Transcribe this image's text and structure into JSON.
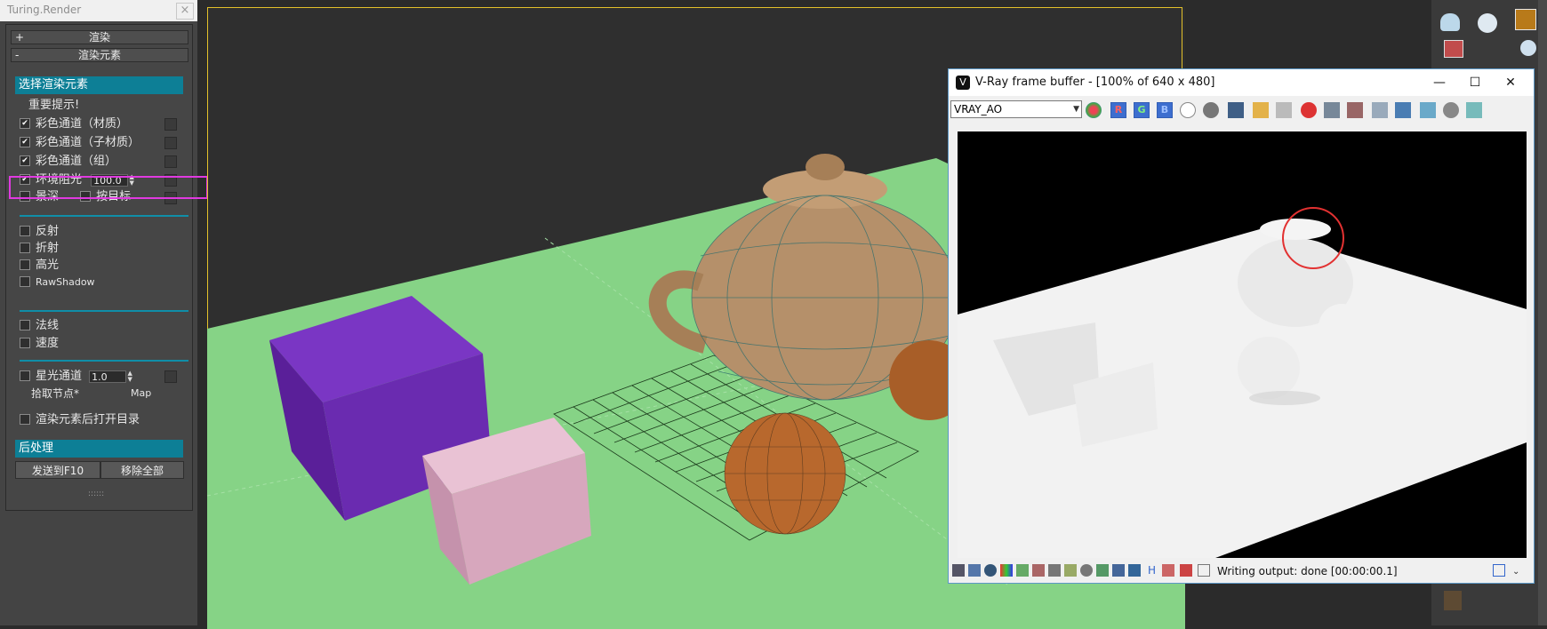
{
  "panel": {
    "title": "Turing.Render",
    "close_label": "×",
    "rollout_render": {
      "sign": "+",
      "label": "渲染"
    },
    "rollout_elements": {
      "sign": "-",
      "label": "渲染元素"
    },
    "select_header": "选择渲染元素",
    "important_note": "重要提示!",
    "channels": [
      {
        "label": "彩色通道（材质）",
        "checked": "✔"
      },
      {
        "label": "彩色通道（子材质）",
        "checked": "✔"
      },
      {
        "label": "彩色通道（组）",
        "checked": "✔"
      }
    ],
    "ao": {
      "label": "环境阻光",
      "checked": "✔",
      "value": "100.0"
    },
    "depth_label": "景深",
    "target_label": "按目标",
    "group2": [
      "反射",
      "折射",
      "高光",
      "RawShadow"
    ],
    "group3": [
      "法线",
      "速度"
    ],
    "glow": {
      "label": "星光通道",
      "value": "1.0"
    },
    "pick_node": "拾取节点*",
    "map": "Map",
    "open_dir": "渲染元素后打开目录",
    "post_header": "后处理",
    "send_btn": "发送到F10",
    "remove_btn": "移除全部",
    "grip": "::::::"
  },
  "vfb": {
    "title": "V-Ray frame buffer - [100% of 640 x 480]",
    "logo": "V",
    "minimize": "—",
    "maximize": "☐",
    "close": "✕",
    "channel": "VRAY_AO",
    "r": "R",
    "g": "G",
    "b": "B",
    "status": "Writing output: done [00:00:00.1]",
    "status_h": "H"
  },
  "colors": {
    "accent": "#0d7f96",
    "highlight": "#e03ae0",
    "ground": "#86d386",
    "box_purple": "#6a2bb0",
    "box_pink": "#e1b1c8",
    "teapot": "#b5906a",
    "sphere": "#b8682d"
  },
  "right_tools": [
    "teapot-icon",
    "teapot-settings-icon",
    "sun-icon",
    "sphere-icon"
  ]
}
